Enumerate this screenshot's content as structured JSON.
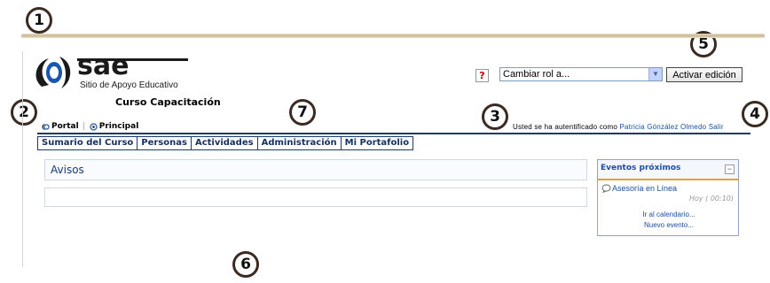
{
  "callouts": [
    "1",
    "2",
    "3",
    "4",
    "5",
    "6",
    "7"
  ],
  "header": {
    "logo_text": "sae",
    "logo_subtitle": "Sitio de Apoyo Educativo",
    "course_name": "Curso Capacitación"
  },
  "role_switch": {
    "help_icon": "?",
    "selected": "Cambiar rol a...",
    "edit_button": "Activar edición"
  },
  "breadcrumb": {
    "items": [
      "Portal",
      "Principal"
    ],
    "separator": "|"
  },
  "login": {
    "prefix": "Usted se ha autentificado como",
    "user": "Patricia Gónzález Olmedo",
    "logout": "Salir"
  },
  "tabs": [
    "Sumario del Curso",
    "Personas",
    "Actividades",
    "Administración",
    "Mi Portafolio"
  ],
  "news": {
    "title": "Avisos"
  },
  "events": {
    "title": "Eventos próximos",
    "collapse": "−",
    "item": "Asesoría en Línea",
    "time": "Hoy ( 00:10)",
    "calendar_link": "Ir al calendario...",
    "new_event_link": "Nuevo evento..."
  },
  "colors": {
    "nav": "#1e3a68",
    "link": "#1c4ea0",
    "accent": "#e8a02a"
  }
}
